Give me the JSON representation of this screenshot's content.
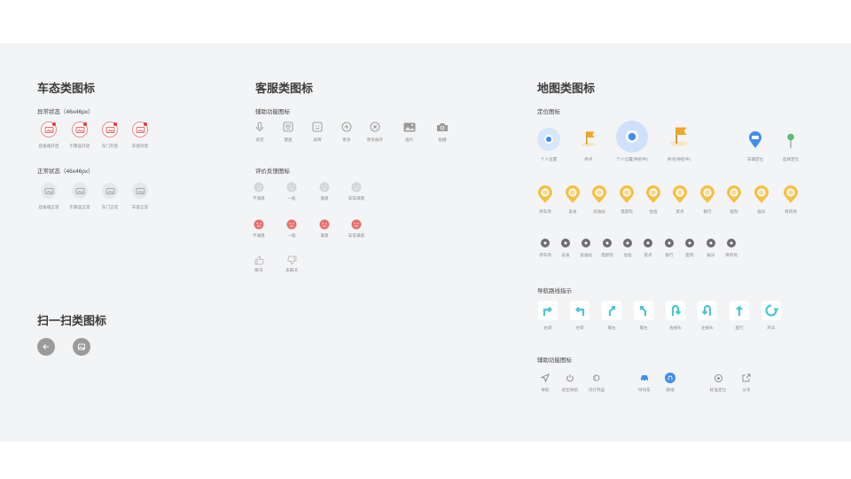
{
  "car_section": {
    "title": "车态类图标",
    "abnormal": {
      "title": "异常状态（46x46px）",
      "items": [
        "后备箱开启",
        "引擎盖开启",
        "车门开启",
        "车窗开启"
      ]
    },
    "normal": {
      "title": "正常状态（46x46px）",
      "items": [
        "后备箱正常",
        "引擎盖正常",
        "车门正常",
        "车窗正常"
      ]
    }
  },
  "scan_section": {
    "title": "扫一扫类图标"
  },
  "service_section": {
    "title": "客服类图标",
    "aux": {
      "title": "辅助功能图标",
      "items": [
        "语音",
        "键盘",
        "表情",
        "更多",
        "更多展开",
        "图片",
        "拍摄"
      ]
    },
    "feedback": {
      "title": "评价反馈图标",
      "row1": [
        "不满意",
        "一般",
        "满意",
        "非常满意"
      ],
      "row2": [
        "不满意",
        "一般",
        "满意",
        "非常满意"
      ],
      "row3": [
        "解决",
        "未解决"
      ]
    }
  },
  "map_section": {
    "title": "地图类图标",
    "locate": {
      "title": "定位图标",
      "items": [
        "个人位置",
        "终点",
        "个人位置(导航中)",
        "终点(导航中)",
        "车辆定位",
        "选择定位"
      ]
    },
    "poi_pins": [
      "停车场",
      "美食",
      "加油站",
      "电影院",
      "住宿",
      "景点",
      "银行",
      "医院",
      "娱乐",
      "目的地"
    ],
    "poi_small": [
      "停车场",
      "美食",
      "加油站",
      "电影院",
      "住宿",
      "景点",
      "银行",
      "医院",
      "娱乐",
      "目的地"
    ],
    "route": {
      "title": "导航路线指示",
      "items": [
        "右转",
        "左转",
        "靠右",
        "靠左",
        "右掉头",
        "左掉头",
        "直行",
        "环岛"
      ]
    },
    "aux": {
      "title": "辅助功能图标",
      "items": [
        "导航",
        "退出导航",
        "闪灯鸣笛",
        "呼叫车",
        "路线",
        "标准定位",
        "分享"
      ]
    }
  },
  "colors": {
    "panel": "#f3f4f6",
    "alert_red": "#e5393c",
    "pin_yellow": "#f5c044",
    "nav_teal": "#49c6d3",
    "locate_blue": "#3f8ef0",
    "map_green": "#5bbd72",
    "flag_orange": "#f4a621"
  }
}
